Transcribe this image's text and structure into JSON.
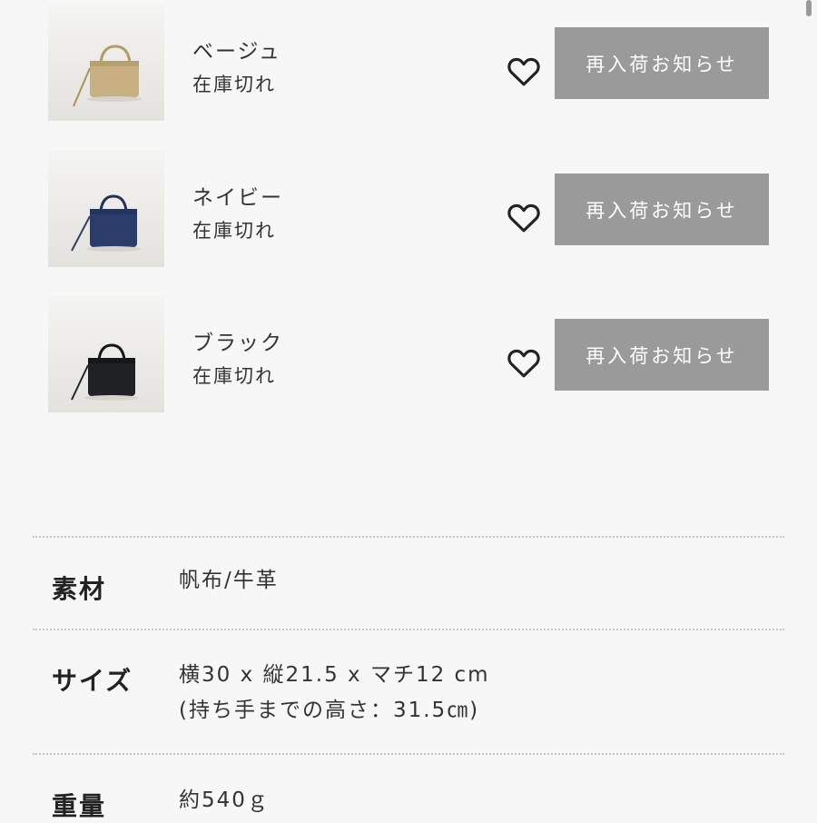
{
  "variants": [
    {
      "color": "ベージュ",
      "stock": "在庫切れ",
      "button": "再入荷お知らせ",
      "bag_color": "#c8b083"
    },
    {
      "color": "ネイビー",
      "stock": "在庫切れ",
      "button": "再入荷お知らせ",
      "bag_color": "#2b3c6b"
    },
    {
      "color": "ブラック",
      "stock": "在庫切れ",
      "button": "再入荷お知らせ",
      "bag_color": "#1f2125"
    }
  ],
  "specs": {
    "material": {
      "label": "素材",
      "value": "帆布/牛革"
    },
    "size": {
      "label": "サイズ",
      "value_line1": "横30 x 縦21.5 x マチ12 cm",
      "value_line2": "(持ち手までの高さ：31.5㎝)"
    },
    "weight": {
      "label": "重量",
      "value": "約540ｇ"
    }
  },
  "colors": {
    "button_bg": "#9a9a9a",
    "button_text": "#ffffff",
    "background": "#f7f7f7"
  },
  "icons": {
    "favorite": "heart-outline-icon"
  }
}
